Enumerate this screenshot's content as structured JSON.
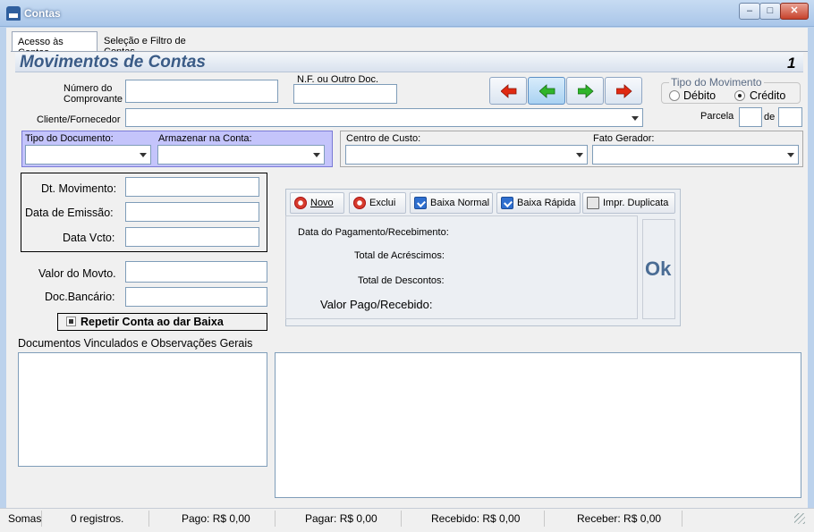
{
  "window": {
    "title": "Contas",
    "minimize": "–",
    "maximize": "□",
    "close": "✕"
  },
  "tabs": [
    {
      "label": "Acesso às Contas",
      "active": true
    },
    {
      "label": "Seleção e Filtro de Contas",
      "active": false
    }
  ],
  "header": {
    "title": "Movimentos de Contas",
    "record_number": "1"
  },
  "fields": {
    "numero_comprovante_label_1": "Número do",
    "numero_comprovante_label_2": "Comprovante",
    "numero_comprovante_value": "",
    "nf_label": "N.F. ou Outro Doc.",
    "nf_value": "",
    "cliente_label": "Cliente/Fornecedor",
    "cliente_value": "",
    "parcela_label": "Parcela",
    "parcela_de_label": "de",
    "parcela_value": "",
    "parcela_total": ""
  },
  "tipo_movimento": {
    "legend": "Tipo do Movimento",
    "options": [
      {
        "label": "Débito",
        "selected": false
      },
      {
        "label": "Crédito",
        "selected": true
      }
    ]
  },
  "documento": {
    "tipo_label": "Tipo do Documento:",
    "tipo_value": "",
    "armazenar_label": "Armazenar na Conta:",
    "armazenar_value": "",
    "centro_label": "Centro de Custo:",
    "centro_value": "",
    "fato_label": "Fato Gerador:",
    "fato_value": ""
  },
  "datas": {
    "movimento_label": "Dt. Movimento:",
    "emissao_label": "Data de Emissão:",
    "vcto_label": "Data Vcto:"
  },
  "valores": {
    "valor_label": "Valor do Movto.",
    "doc_bancario_label": "Doc.Bancário:"
  },
  "repetir_label": "Repetir Conta ao dar Baixa",
  "repetir_checked": true,
  "actions": {
    "novo": "Novo",
    "exclui": "Exclui",
    "baixa_normal": "Baixa Normal",
    "baixa_rapida": "Baixa Rápida",
    "impr_duplicata": "Impr. Duplicata"
  },
  "pagamento": {
    "data_label": "Data do Pagamento/Recebimento:",
    "acrescimos_label": "Total de Acréscimos:",
    "descontos_label": "Total de Descontos:",
    "valor_pago_label": "Valor Pago/Recebido:",
    "ok_label": "Ok"
  },
  "observacoes_label": "Documentos Vinculados e Observações Gerais",
  "status": {
    "somas": "Somas",
    "registros": "0 registros.",
    "pago": "Pago: R$ 0,00",
    "pagar": "Pagar: R$ 0,00",
    "recebido": "Recebido: R$ 0,00",
    "receber": "Receber: R$ 0,00"
  }
}
